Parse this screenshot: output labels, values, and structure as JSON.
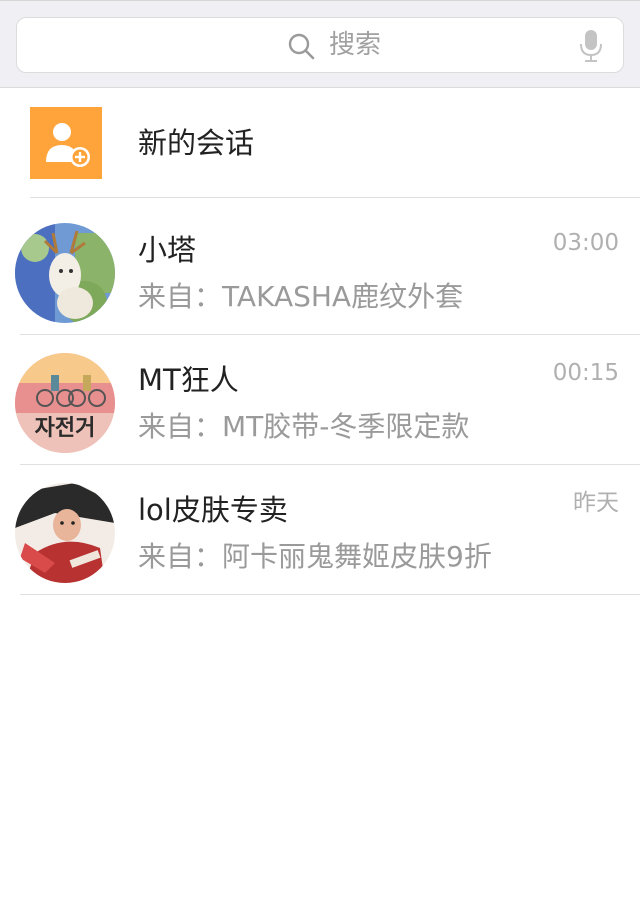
{
  "search": {
    "placeholder": "搜索"
  },
  "new_conversation": {
    "label": "新的会话",
    "icon": "add-contact-icon",
    "icon_color": "#ffa43a"
  },
  "conversations": [
    {
      "name": "小塔",
      "preview": "来自：TAKASHA鹿纹外套",
      "time": "03:00",
      "avatar": "deer-illustration-avatar"
    },
    {
      "name": "MT狂人",
      "preview": "来自：MT胶带-冬季限定款",
      "time": "00:15",
      "avatar": "cyclists-illustration-avatar"
    },
    {
      "name": "lol皮肤专卖",
      "preview": "来自：阿卡丽鬼舞姬皮肤9折",
      "time": "昨天",
      "avatar": "game-character-avatar"
    }
  ],
  "colors": {
    "search_bg": "#efeff4",
    "accent": "#ffa43a",
    "name_text": "#222222",
    "preview_text": "#9a9a9a",
    "time_text": "#b0b0b0"
  }
}
